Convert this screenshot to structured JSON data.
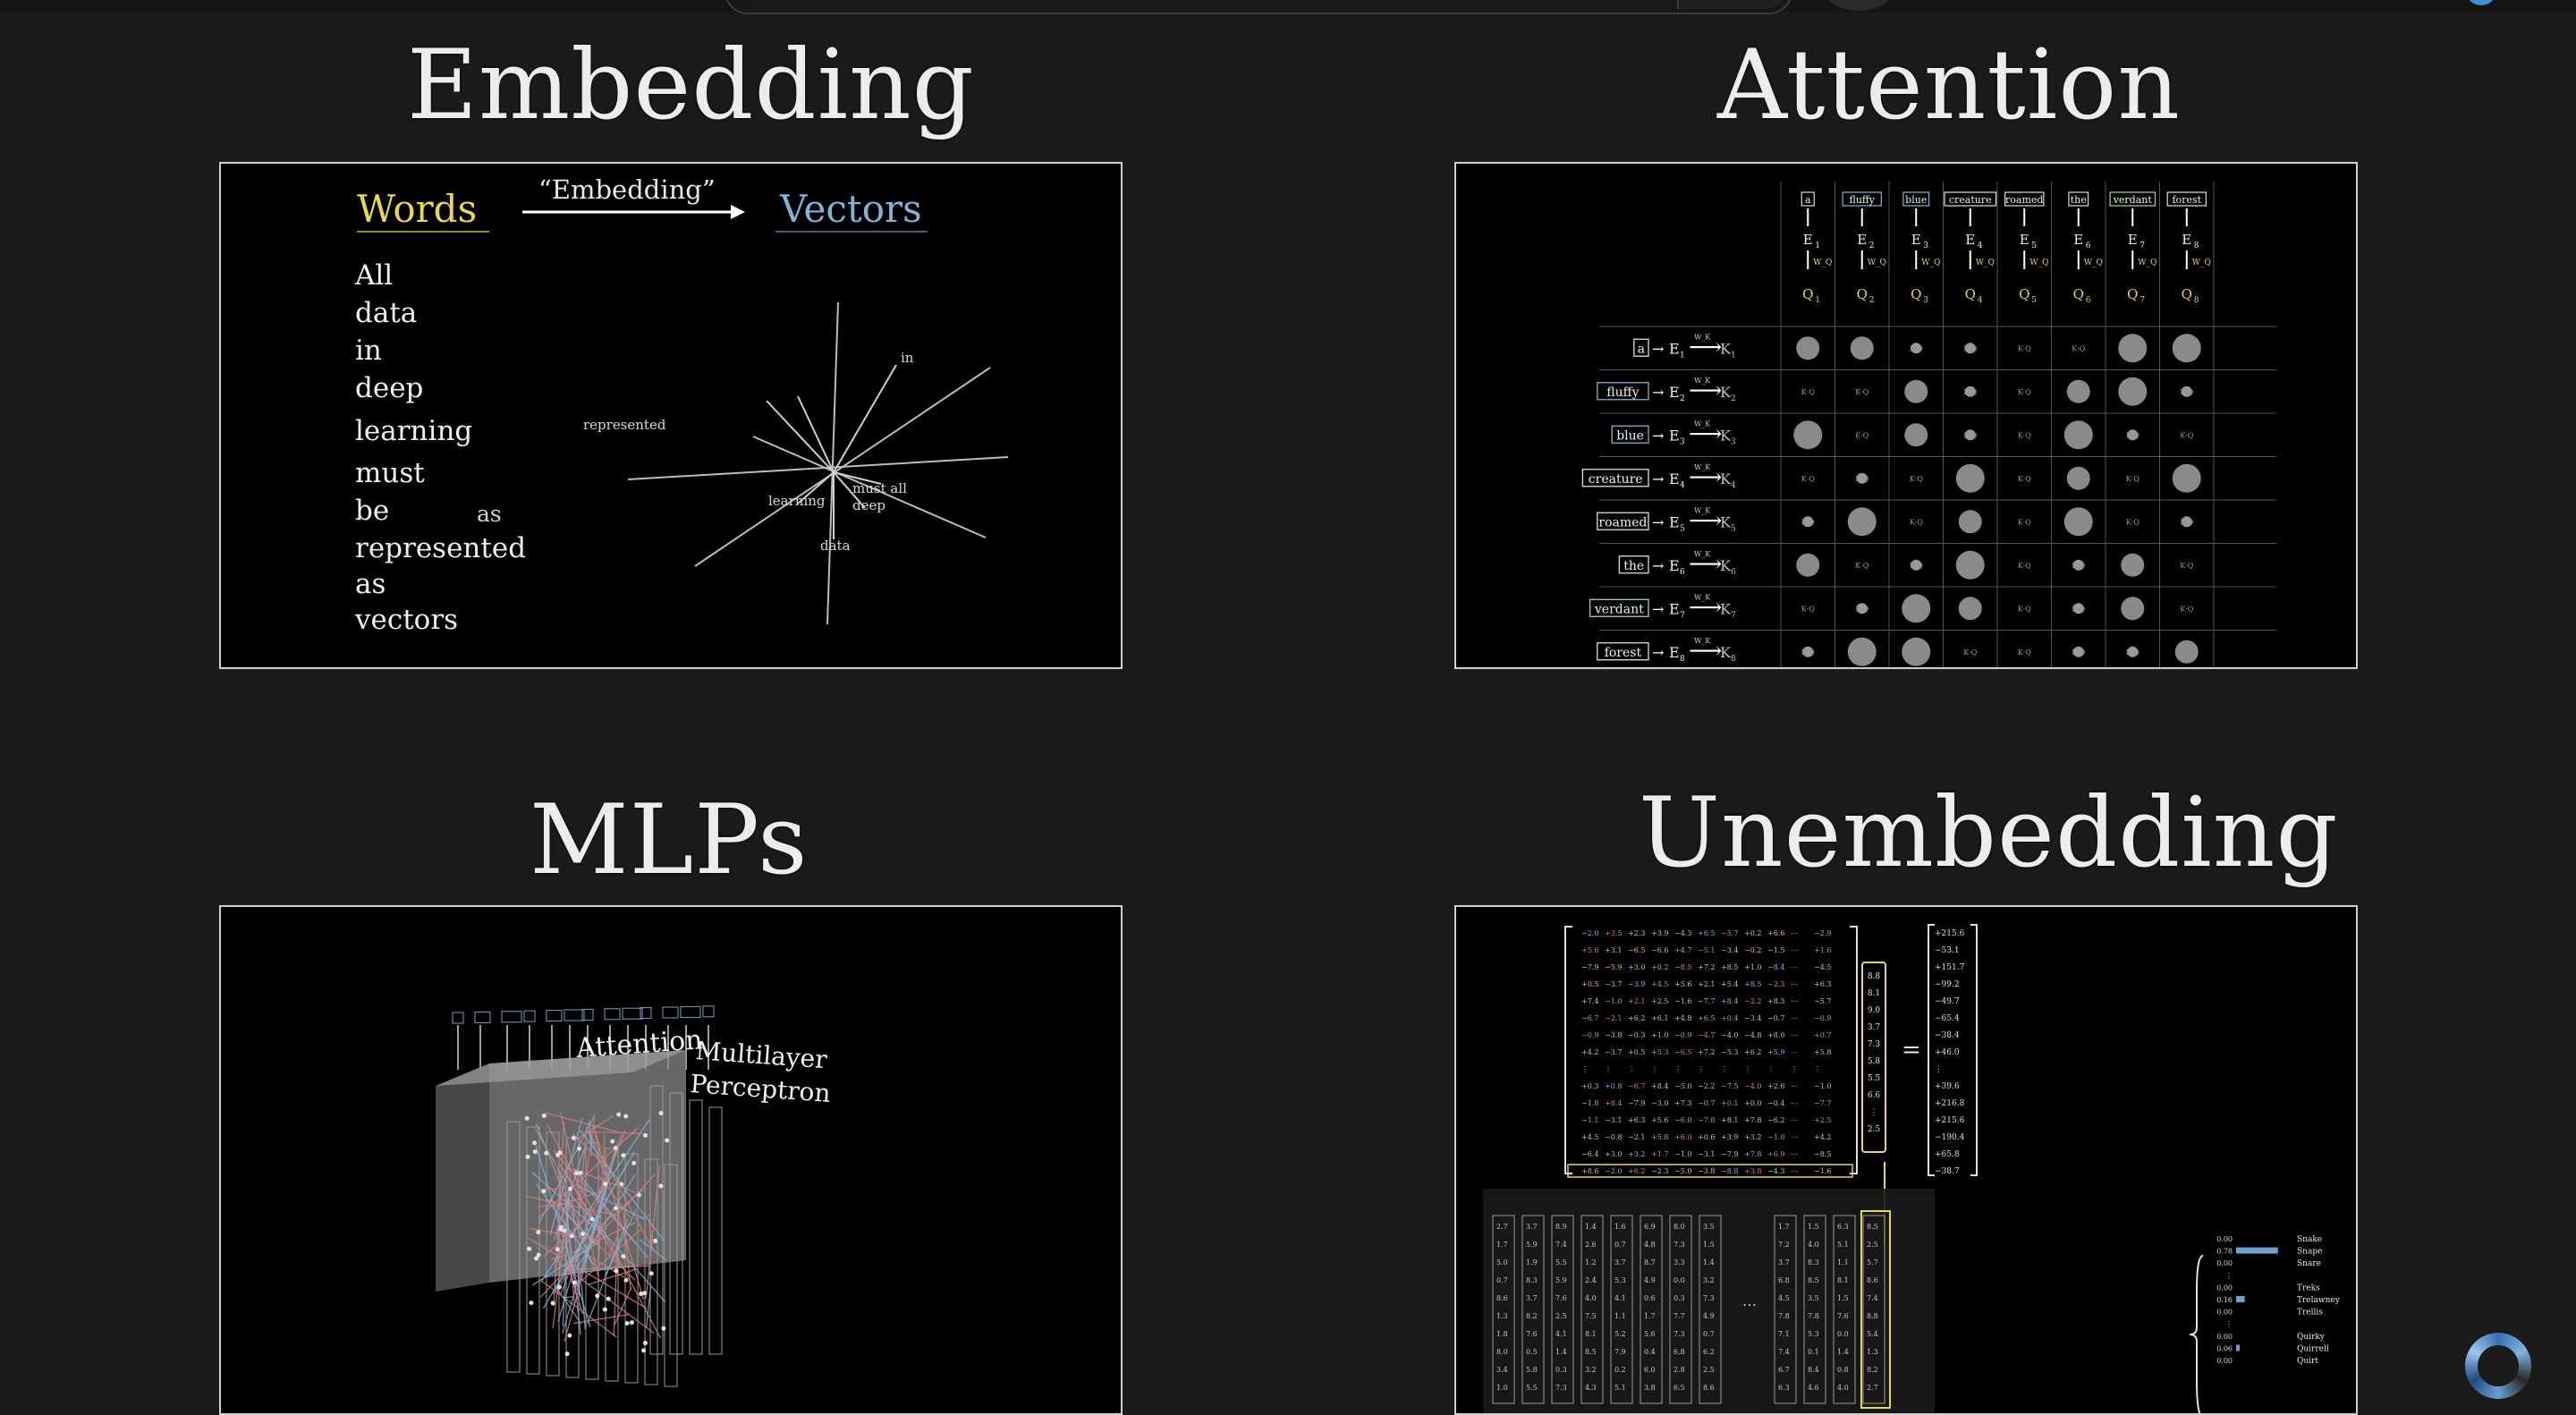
{
  "sections": {
    "embedding": {
      "title": "Embedding"
    },
    "attention": {
      "title": "Attention"
    },
    "mlps": {
      "title": "MLPs"
    },
    "unembedding": {
      "title": "Unembedding"
    }
  },
  "embedding_panel": {
    "words_label": "Words",
    "arrow_label": "“Embedding”",
    "vectors_label": "Vectors",
    "sentence": [
      "All",
      "data",
      "in",
      "deep",
      "learning",
      "must",
      "be",
      "represented",
      "as",
      "vectors"
    ],
    "stray_word": "as",
    "plot_labels": {
      "represented": "represented",
      "in": "in",
      "learning": "learning",
      "must_all": "must all",
      "deep": "deep",
      "data": "data"
    }
  },
  "attention_panel": {
    "tokens": [
      "a",
      "fluffy",
      "blue",
      "creature",
      "roamed",
      "the",
      "verdant",
      "forest"
    ],
    "query_weight": "W_Q",
    "key_weight": "W_K"
  },
  "mlp_panel": {
    "attention_label": "Attention",
    "mlp_label_1": "Multilayer",
    "mlp_label_2": "Perceptron"
  },
  "unembedding_panel": {
    "equals": "=",
    "result_column": [
      "+215.6",
      "−53.1",
      "+151.7",
      "−99.2",
      "−49.7",
      "−65.4",
      "−38.4",
      "+46.0",
      "⋮",
      "+39.6",
      "+216.8",
      "+215.6",
      "−190.4",
      "+65.8",
      "−38.7"
    ],
    "vector_column": [
      "8.8",
      "8.1",
      "9.0",
      "3.7",
      "7.3",
      "5.8",
      "5.5",
      "6.6",
      "⋮",
      "2.5"
    ],
    "candidates": [
      {
        "prob": "0.00",
        "word": "Snake"
      },
      {
        "prob": "0.78",
        "word": "Snape"
      },
      {
        "prob": "0.00",
        "word": "Snare"
      },
      {
        "prob": "⋮",
        "word": ""
      },
      {
        "prob": "0.00",
        "word": "Treks"
      },
      {
        "prob": "0.16",
        "word": "Trelawney"
      },
      {
        "prob": "0.00",
        "word": "Trellis"
      },
      {
        "prob": "⋮",
        "word": ""
      },
      {
        "prob": "0.00",
        "word": "Quirky"
      },
      {
        "prob": "0.06",
        "word": "Quirrell"
      },
      {
        "prob": "0.00",
        "word": "Quirt"
      }
    ]
  }
}
